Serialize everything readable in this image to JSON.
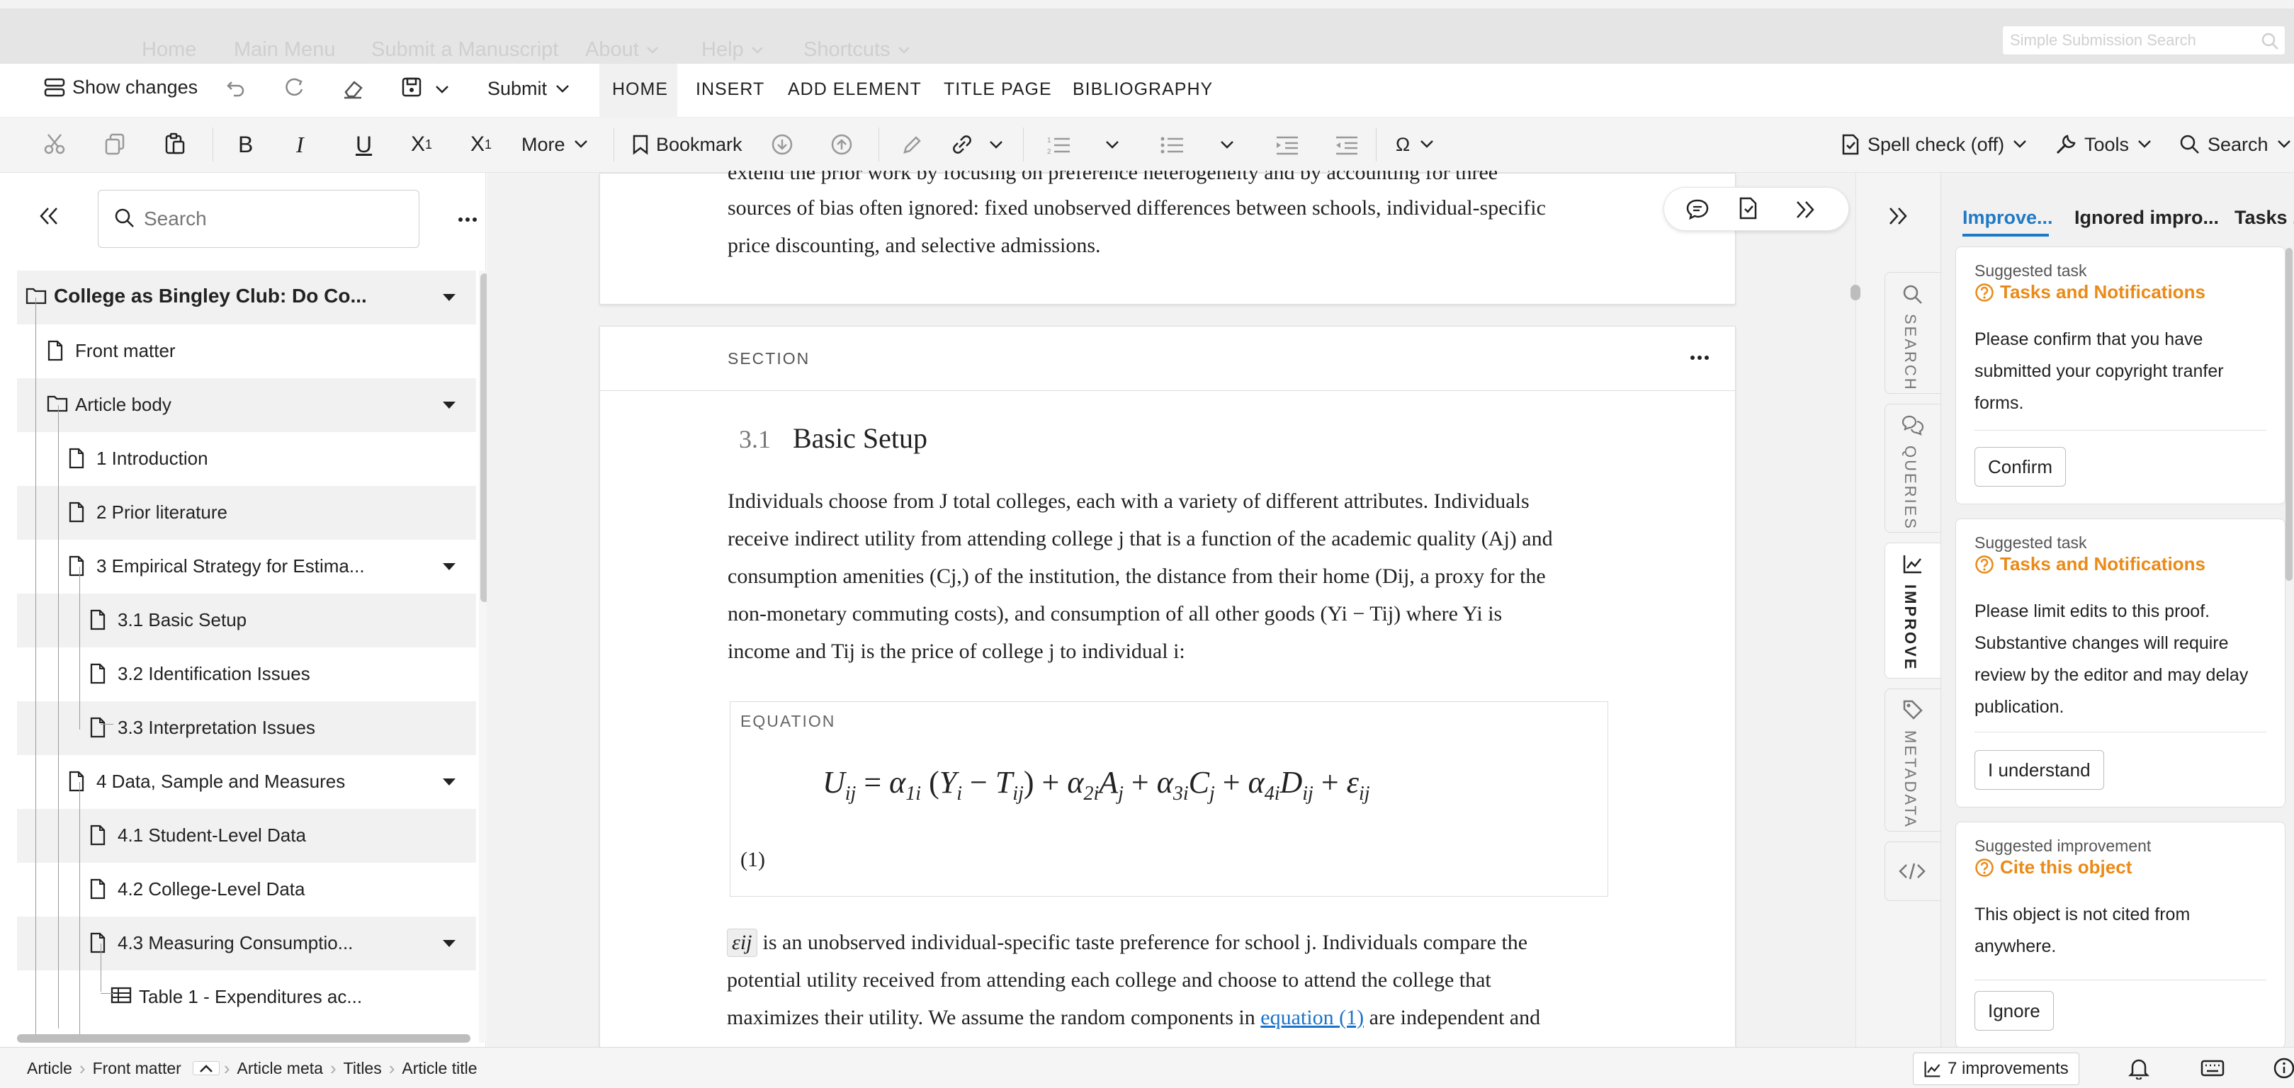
{
  "topnav": {
    "items": [
      "Home",
      "Main Menu",
      "Submit a Manuscript",
      "About",
      "Help",
      "Shortcuts"
    ],
    "search_placeholder": "Simple Submission Search"
  },
  "toolbar": {
    "show_changes": "Show changes",
    "submit": "Submit",
    "tabs": [
      "HOME",
      "INSERT",
      "ADD ELEMENT",
      "TITLE PAGE",
      "BIBLIOGRAPHY"
    ],
    "format": {
      "bold": "B",
      "italic": "I",
      "underline": "U",
      "subscript": "X",
      "subscript_mark": "1",
      "superscript": "X",
      "superscript_mark": "1",
      "more": "More",
      "bookmark": "Bookmark",
      "omega": "Ω"
    },
    "spell_check": "Spell check (off)",
    "tools": "Tools",
    "search": "Search"
  },
  "sidebar": {
    "search_placeholder": "Search",
    "tree": [
      {
        "label": "College as Bingley Club: Do Co...",
        "bold": true,
        "icon": "folder",
        "caret": true,
        "shade": true
      },
      {
        "label": "Front matter",
        "icon": "page",
        "caret": false,
        "shade": false
      },
      {
        "label": "Article body",
        "icon": "folder",
        "caret": true,
        "shade": true
      },
      {
        "label": "1 Introduction",
        "icon": "page",
        "caret": false,
        "shade": false
      },
      {
        "label": "2 Prior literature",
        "icon": "page",
        "caret": false,
        "shade": true
      },
      {
        "label": "3 Empirical Strategy for Estima...",
        "icon": "page",
        "caret": true,
        "shade": false
      },
      {
        "label": "3.1 Basic Setup",
        "icon": "page",
        "caret": false,
        "shade": true
      },
      {
        "label": "3.2 Identification Issues",
        "icon": "page",
        "caret": false,
        "shade": false
      },
      {
        "label": "3.3 Interpretation Issues",
        "icon": "page",
        "caret": false,
        "shade": true
      },
      {
        "label": "4 Data, Sample and Measures",
        "icon": "page",
        "caret": true,
        "shade": false
      },
      {
        "label": "4.1 Student-Level Data",
        "icon": "page",
        "caret": false,
        "shade": true
      },
      {
        "label": "4.2 College-Level Data",
        "icon": "page",
        "caret": false,
        "shade": false
      },
      {
        "label": "4.3 Measuring Consumptio...",
        "icon": "page",
        "caret": true,
        "shade": true
      },
      {
        "label": "Table 1 - Expenditures ac...",
        "icon": "table",
        "caret": false,
        "shade": false
      }
    ]
  },
  "editor": {
    "prev_partial": "extend the prior work by focusing on preference heterogeneity and by accounting for three",
    "prev_line1": "sources of bias often ignored: fixed unobserved differences between schools, individual-specific",
    "prev_line2": "price discounting, and selective admissions.",
    "section_label": "SECTION",
    "section_number": "3.1",
    "section_title": "Basic Setup",
    "para1": [
      "Individuals choose from J total colleges, each with a variety of different attributes. Individuals",
      "receive indirect utility from attending college j that is a function of the academic quality (Aj) and",
      "consumption amenities (Cj,) of the institution, the distance from their home (Dij, a proxy for the",
      "non-monetary commuting costs), and consumption of all other goods (Yi − Tij) where Yi is",
      "income and Tij is the price of college j to individual i:"
    ],
    "equation_label": "EQUATION",
    "equation_number": "(1)",
    "epsilon_chip": "εij",
    "para2_line1": "is an unobserved individual-specific taste preference for school j. Individuals compare the",
    "para2_line2": "potential utility received from attending each college and choose to attend the college that",
    "para2_line3_pre": "maximizes their utility. We assume the random components in",
    "para2_link": "equation (1)",
    "para2_line3_post": "are independent and"
  },
  "vtabs": [
    "SEARCH",
    "QUERIES",
    "IMPROVE",
    "METADATA"
  ],
  "rpanel": {
    "tabs": [
      "Improve...",
      "Ignored impro...",
      "Tasks ..."
    ],
    "cards": [
      {
        "kind": "Suggested task",
        "title": "Tasks and Notifications",
        "desc": "Please confirm that you have submitted your copyright tranfer forms.",
        "button": "Confirm"
      },
      {
        "kind": "Suggested task",
        "title": "Tasks and Notifications",
        "desc": "Please limit edits to this proof. Substantive changes will require review by the editor and may delay publication.",
        "button": "I understand"
      },
      {
        "kind": "Suggested improvement",
        "title": "Cite this object",
        "desc": "This object is not cited from anywhere.",
        "button": "Ignore"
      }
    ]
  },
  "statusbar": {
    "breadcrumbs": [
      "Article",
      "Front matter",
      "Article meta",
      "Titles",
      "Article title"
    ],
    "improvements": "7 improvements"
  },
  "colors": {
    "accent_blue": "#1f7ac6",
    "task_orange": "#ea8a17",
    "link_blue": "#1a73c9"
  }
}
